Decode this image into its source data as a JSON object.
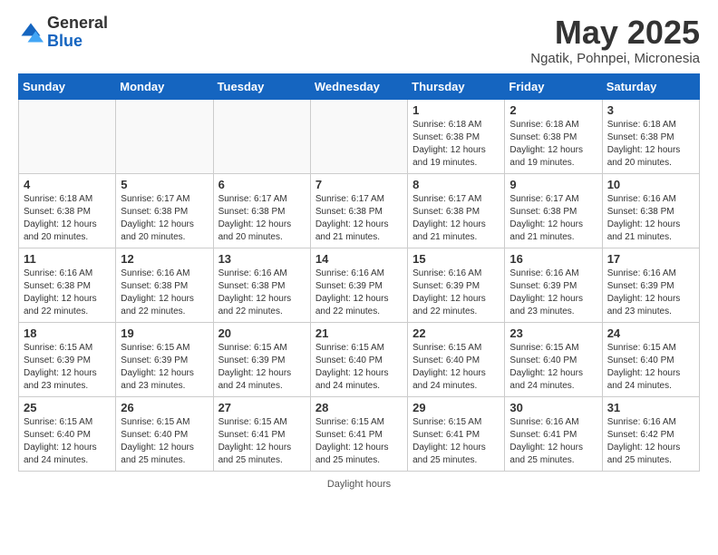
{
  "logo": {
    "general": "General",
    "blue": "Blue"
  },
  "title": "May 2025",
  "location": "Ngatik, Pohnpei, Micronesia",
  "days_of_week": [
    "Sunday",
    "Monday",
    "Tuesday",
    "Wednesday",
    "Thursday",
    "Friday",
    "Saturday"
  ],
  "footer": "Daylight hours",
  "weeks": [
    [
      {
        "day": "",
        "info": ""
      },
      {
        "day": "",
        "info": ""
      },
      {
        "day": "",
        "info": ""
      },
      {
        "day": "",
        "info": ""
      },
      {
        "day": "1",
        "info": "Sunrise: 6:18 AM\nSunset: 6:38 PM\nDaylight: 12 hours\nand 19 minutes."
      },
      {
        "day": "2",
        "info": "Sunrise: 6:18 AM\nSunset: 6:38 PM\nDaylight: 12 hours\nand 19 minutes."
      },
      {
        "day": "3",
        "info": "Sunrise: 6:18 AM\nSunset: 6:38 PM\nDaylight: 12 hours\nand 20 minutes."
      }
    ],
    [
      {
        "day": "4",
        "info": "Sunrise: 6:18 AM\nSunset: 6:38 PM\nDaylight: 12 hours\nand 20 minutes."
      },
      {
        "day": "5",
        "info": "Sunrise: 6:17 AM\nSunset: 6:38 PM\nDaylight: 12 hours\nand 20 minutes."
      },
      {
        "day": "6",
        "info": "Sunrise: 6:17 AM\nSunset: 6:38 PM\nDaylight: 12 hours\nand 20 minutes."
      },
      {
        "day": "7",
        "info": "Sunrise: 6:17 AM\nSunset: 6:38 PM\nDaylight: 12 hours\nand 21 minutes."
      },
      {
        "day": "8",
        "info": "Sunrise: 6:17 AM\nSunset: 6:38 PM\nDaylight: 12 hours\nand 21 minutes."
      },
      {
        "day": "9",
        "info": "Sunrise: 6:17 AM\nSunset: 6:38 PM\nDaylight: 12 hours\nand 21 minutes."
      },
      {
        "day": "10",
        "info": "Sunrise: 6:16 AM\nSunset: 6:38 PM\nDaylight: 12 hours\nand 21 minutes."
      }
    ],
    [
      {
        "day": "11",
        "info": "Sunrise: 6:16 AM\nSunset: 6:38 PM\nDaylight: 12 hours\nand 22 minutes."
      },
      {
        "day": "12",
        "info": "Sunrise: 6:16 AM\nSunset: 6:38 PM\nDaylight: 12 hours\nand 22 minutes."
      },
      {
        "day": "13",
        "info": "Sunrise: 6:16 AM\nSunset: 6:38 PM\nDaylight: 12 hours\nand 22 minutes."
      },
      {
        "day": "14",
        "info": "Sunrise: 6:16 AM\nSunset: 6:39 PM\nDaylight: 12 hours\nand 22 minutes."
      },
      {
        "day": "15",
        "info": "Sunrise: 6:16 AM\nSunset: 6:39 PM\nDaylight: 12 hours\nand 22 minutes."
      },
      {
        "day": "16",
        "info": "Sunrise: 6:16 AM\nSunset: 6:39 PM\nDaylight: 12 hours\nand 23 minutes."
      },
      {
        "day": "17",
        "info": "Sunrise: 6:16 AM\nSunset: 6:39 PM\nDaylight: 12 hours\nand 23 minutes."
      }
    ],
    [
      {
        "day": "18",
        "info": "Sunrise: 6:15 AM\nSunset: 6:39 PM\nDaylight: 12 hours\nand 23 minutes."
      },
      {
        "day": "19",
        "info": "Sunrise: 6:15 AM\nSunset: 6:39 PM\nDaylight: 12 hours\nand 23 minutes."
      },
      {
        "day": "20",
        "info": "Sunrise: 6:15 AM\nSunset: 6:39 PM\nDaylight: 12 hours\nand 24 minutes."
      },
      {
        "day": "21",
        "info": "Sunrise: 6:15 AM\nSunset: 6:40 PM\nDaylight: 12 hours\nand 24 minutes."
      },
      {
        "day": "22",
        "info": "Sunrise: 6:15 AM\nSunset: 6:40 PM\nDaylight: 12 hours\nand 24 minutes."
      },
      {
        "day": "23",
        "info": "Sunrise: 6:15 AM\nSunset: 6:40 PM\nDaylight: 12 hours\nand 24 minutes."
      },
      {
        "day": "24",
        "info": "Sunrise: 6:15 AM\nSunset: 6:40 PM\nDaylight: 12 hours\nand 24 minutes."
      }
    ],
    [
      {
        "day": "25",
        "info": "Sunrise: 6:15 AM\nSunset: 6:40 PM\nDaylight: 12 hours\nand 24 minutes."
      },
      {
        "day": "26",
        "info": "Sunrise: 6:15 AM\nSunset: 6:40 PM\nDaylight: 12 hours\nand 25 minutes."
      },
      {
        "day": "27",
        "info": "Sunrise: 6:15 AM\nSunset: 6:41 PM\nDaylight: 12 hours\nand 25 minutes."
      },
      {
        "day": "28",
        "info": "Sunrise: 6:15 AM\nSunset: 6:41 PM\nDaylight: 12 hours\nand 25 minutes."
      },
      {
        "day": "29",
        "info": "Sunrise: 6:15 AM\nSunset: 6:41 PM\nDaylight: 12 hours\nand 25 minutes."
      },
      {
        "day": "30",
        "info": "Sunrise: 6:16 AM\nSunset: 6:41 PM\nDaylight: 12 hours\nand 25 minutes."
      },
      {
        "day": "31",
        "info": "Sunrise: 6:16 AM\nSunset: 6:42 PM\nDaylight: 12 hours\nand 25 minutes."
      }
    ]
  ]
}
